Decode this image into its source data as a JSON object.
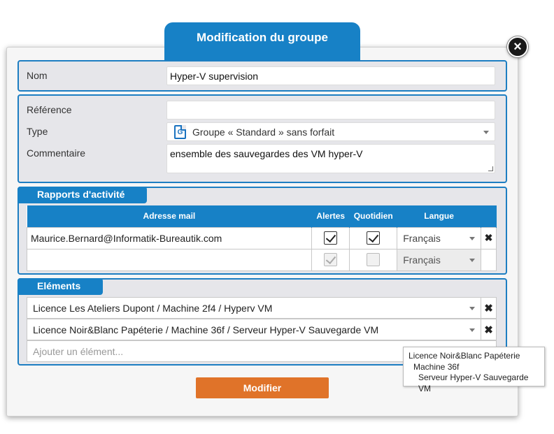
{
  "dialog": {
    "title": "Modification du groupe",
    "close_glyph": "×"
  },
  "general": {
    "nom_label": "Nom",
    "nom_value": "Hyper-V supervision"
  },
  "details": {
    "reference_label": "Référence",
    "reference_value": "",
    "type_label": "Type",
    "type_value": "Groupe « Standard » sans forfait",
    "type_icon_letter": "G",
    "type_icon": "document-icon",
    "commentaire_label": "Commentaire",
    "commentaire_value": "ensemble des sauvegardes des VM hyper-V"
  },
  "rapports": {
    "section_title": "Rapports d'activité",
    "columns": [
      "Adresse mail",
      "Alertes",
      "Quotidien",
      "Langue"
    ],
    "rows": [
      {
        "email": "Maurice.Bernard@Informatik-Bureautik.com",
        "alertes": true,
        "quotidien": true,
        "langue": "Français",
        "removable": true
      },
      {
        "email": "",
        "alertes": true,
        "quotidien": false,
        "langue": "Français",
        "removable": false
      }
    ],
    "remove_glyph": "✖"
  },
  "elements": {
    "section_title": "Eléments",
    "items": [
      "Licence Les Ateliers Dupont / Machine 2f4 / Hyperv VM",
      "Licence Noir&Blanc Papéterie / Machine 36f / Serveur Hyper-V Sauvegarde VM"
    ],
    "add_placeholder": "Ajouter un élément...",
    "remove_glyph": "✖"
  },
  "tooltip": {
    "line1": "Licence Noir&Blanc Papéterie",
    "line2": "Machine 36f",
    "line3": "Serveur Hyper-V Sauvegarde VM"
  },
  "actions": {
    "submit_label": "Modifier"
  },
  "colors": {
    "accent": "#1781c6",
    "submit": "#e07329",
    "section_bg": "#e6e6ea"
  }
}
